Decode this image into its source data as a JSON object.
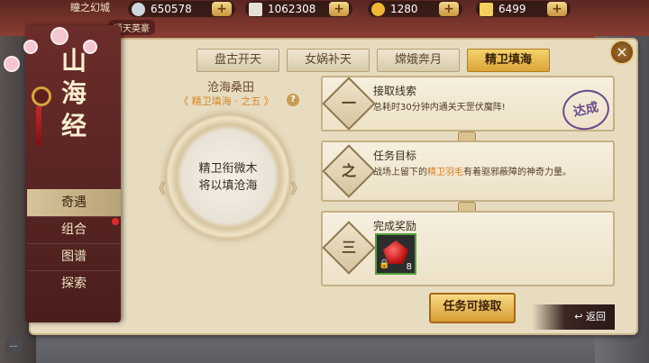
{
  "server": {
    "name": "瞳之幻城",
    "subtitle": "通天英豪"
  },
  "resources": [
    {
      "name": "silver",
      "value": "650578",
      "icon": "silver-coin-icon",
      "color": "#cfd6e0"
    },
    {
      "name": "scroll",
      "value": "1062308",
      "icon": "scroll-icon",
      "color": "#e6e1d7"
    },
    {
      "name": "gold",
      "value": "1280",
      "icon": "gold-ingot-icon",
      "color": "#f2b636"
    },
    {
      "name": "ticket",
      "value": "6499",
      "icon": "ticket-icon",
      "color": "#f3cf5e"
    }
  ],
  "plus_label": "+",
  "book": {
    "title": "山海经"
  },
  "nav": [
    {
      "label": "奇遇",
      "active": true
    },
    {
      "label": "组合",
      "active": false
    },
    {
      "label": "图谱",
      "active": false
    },
    {
      "label": "探索",
      "active": false
    }
  ],
  "tabs": [
    {
      "label": "盘古开天",
      "active": false
    },
    {
      "label": "女娲补天",
      "active": false
    },
    {
      "label": "嫦娥奔月",
      "active": false
    },
    {
      "label": "精卫填海",
      "active": true
    }
  ],
  "close_label": "×",
  "story": {
    "title": "沧海桑田",
    "subtitle": "《 精卫填海 · 之五 》",
    "help": "?",
    "caption_line1": "精卫衔微木",
    "caption_line2": "将以填沧海"
  },
  "cards": {
    "accept": {
      "numeral": "一",
      "title": "接取线索",
      "desc": "总耗时30分钟内通关天罡伏魔阵!",
      "stamp": "达成"
    },
    "goal": {
      "numeral": "之",
      "title": "任务目标",
      "desc_pre": "战场上留下的",
      "desc_hl": "精卫羽毛",
      "desc_post": "有着驱邪蔽障的神奇力量。"
    },
    "reward": {
      "numeral": "三",
      "title": "完成奖励",
      "item_count": "8",
      "item_icon": "red-crystal-icon"
    }
  },
  "buttons": {
    "accept": "任务可接取",
    "back": "返回",
    "chat": "..."
  }
}
